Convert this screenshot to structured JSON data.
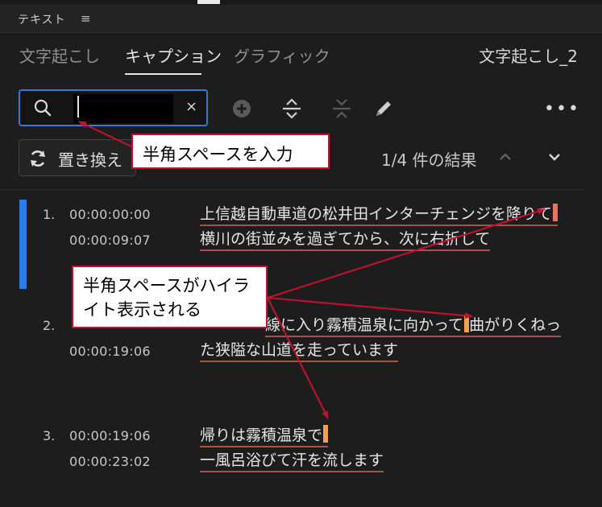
{
  "panel": {
    "title": "テキスト",
    "menu_icon": "≡"
  },
  "tabs": [
    {
      "label": "文字起こし",
      "active": false
    },
    {
      "label": "キャプション",
      "active": true
    },
    {
      "label": "グラフィック",
      "active": false
    }
  ],
  "project_name": "文字起こし_2",
  "search": {
    "value": "",
    "placeholder": "",
    "clear_icon": "×"
  },
  "toolbar": {
    "more_label": "•••"
  },
  "replace": {
    "label": "置き換え"
  },
  "results": {
    "count_text": "1/4 件の結果"
  },
  "captions": [
    {
      "num": "1.",
      "start": "00:00:00:00",
      "end": "00:00:09:07",
      "line1": "上信越自動車道の松井田インターチェンジを降りて",
      "line2": "横川の街並みを過ぎてから、次に右折して"
    },
    {
      "num": "2.",
      "start": "",
      "end": "00:00:19:06",
      "line1_pre": "線に入り霧積温泉に向かって",
      "line1_post": "曲がりくねっ",
      "line2": "た狭隘な山道を走っています"
    },
    {
      "num": "3.",
      "start": "00:00:19:06",
      "end": "00:00:23:02",
      "line1": "帰りは霧積温泉で",
      "line2": "一風呂浴びて汗を流します"
    }
  ],
  "annotations": {
    "callout_1": "半角スペースを入力",
    "callout_2_line1": "半角スペースがハイラ",
    "callout_2_line2": "イト表示される"
  },
  "colors": {
    "accent_blue": "#2d7be5",
    "highlight_orange": "#f1a251",
    "highlight_red": "#ee7060",
    "annotation_red": "#c8102e"
  }
}
